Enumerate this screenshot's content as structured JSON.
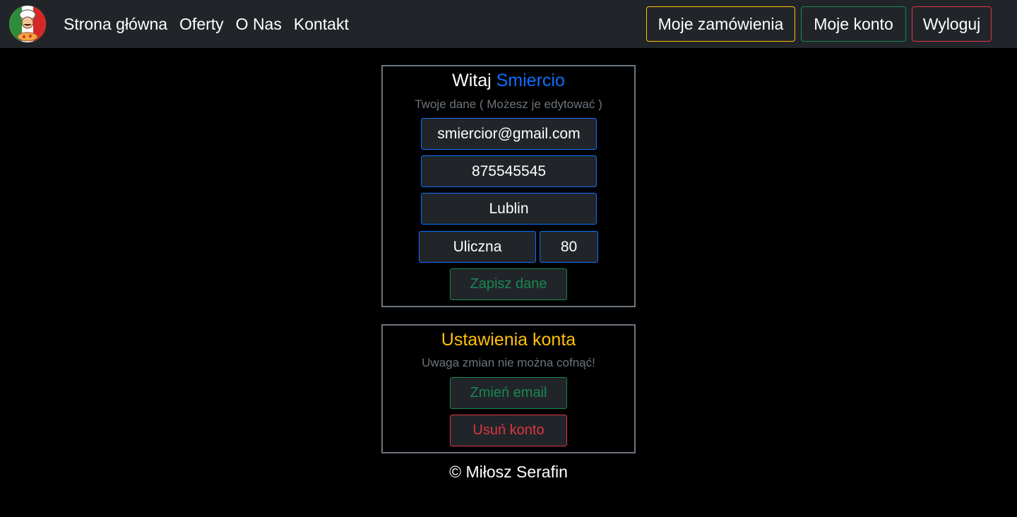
{
  "nav": {
    "links": [
      "Strona główna",
      "Oferty",
      "O Nas",
      "Kontakt"
    ],
    "buttons": {
      "orders": "Moje zamówienia",
      "account": "Moje konto",
      "logout": "Wyloguj"
    }
  },
  "profile": {
    "greeting": "Witaj",
    "username": "Smiercio",
    "subtitle": "Twoje dane ( Możesz je edytować )",
    "email": "smiercior@gmail.com",
    "phone": "875545545",
    "city": "Lublin",
    "street": "Uliczna",
    "number": "80",
    "save_label": "Zapisz dane"
  },
  "settings": {
    "title": "Ustawienia konta",
    "warning": "Uwaga zmian nie można cofnąć!",
    "change_email_label": "Zmień email",
    "delete_label": "Usuń konto"
  },
  "footer": {
    "text": "© Miłosz Serafin"
  },
  "colors": {
    "navbar": "#212529",
    "username": "#0d6efd",
    "settings_title": "#ffc107",
    "success": "#198754",
    "danger": "#dc3545"
  },
  "icons": {
    "logo": "chef-pizza-logo"
  }
}
